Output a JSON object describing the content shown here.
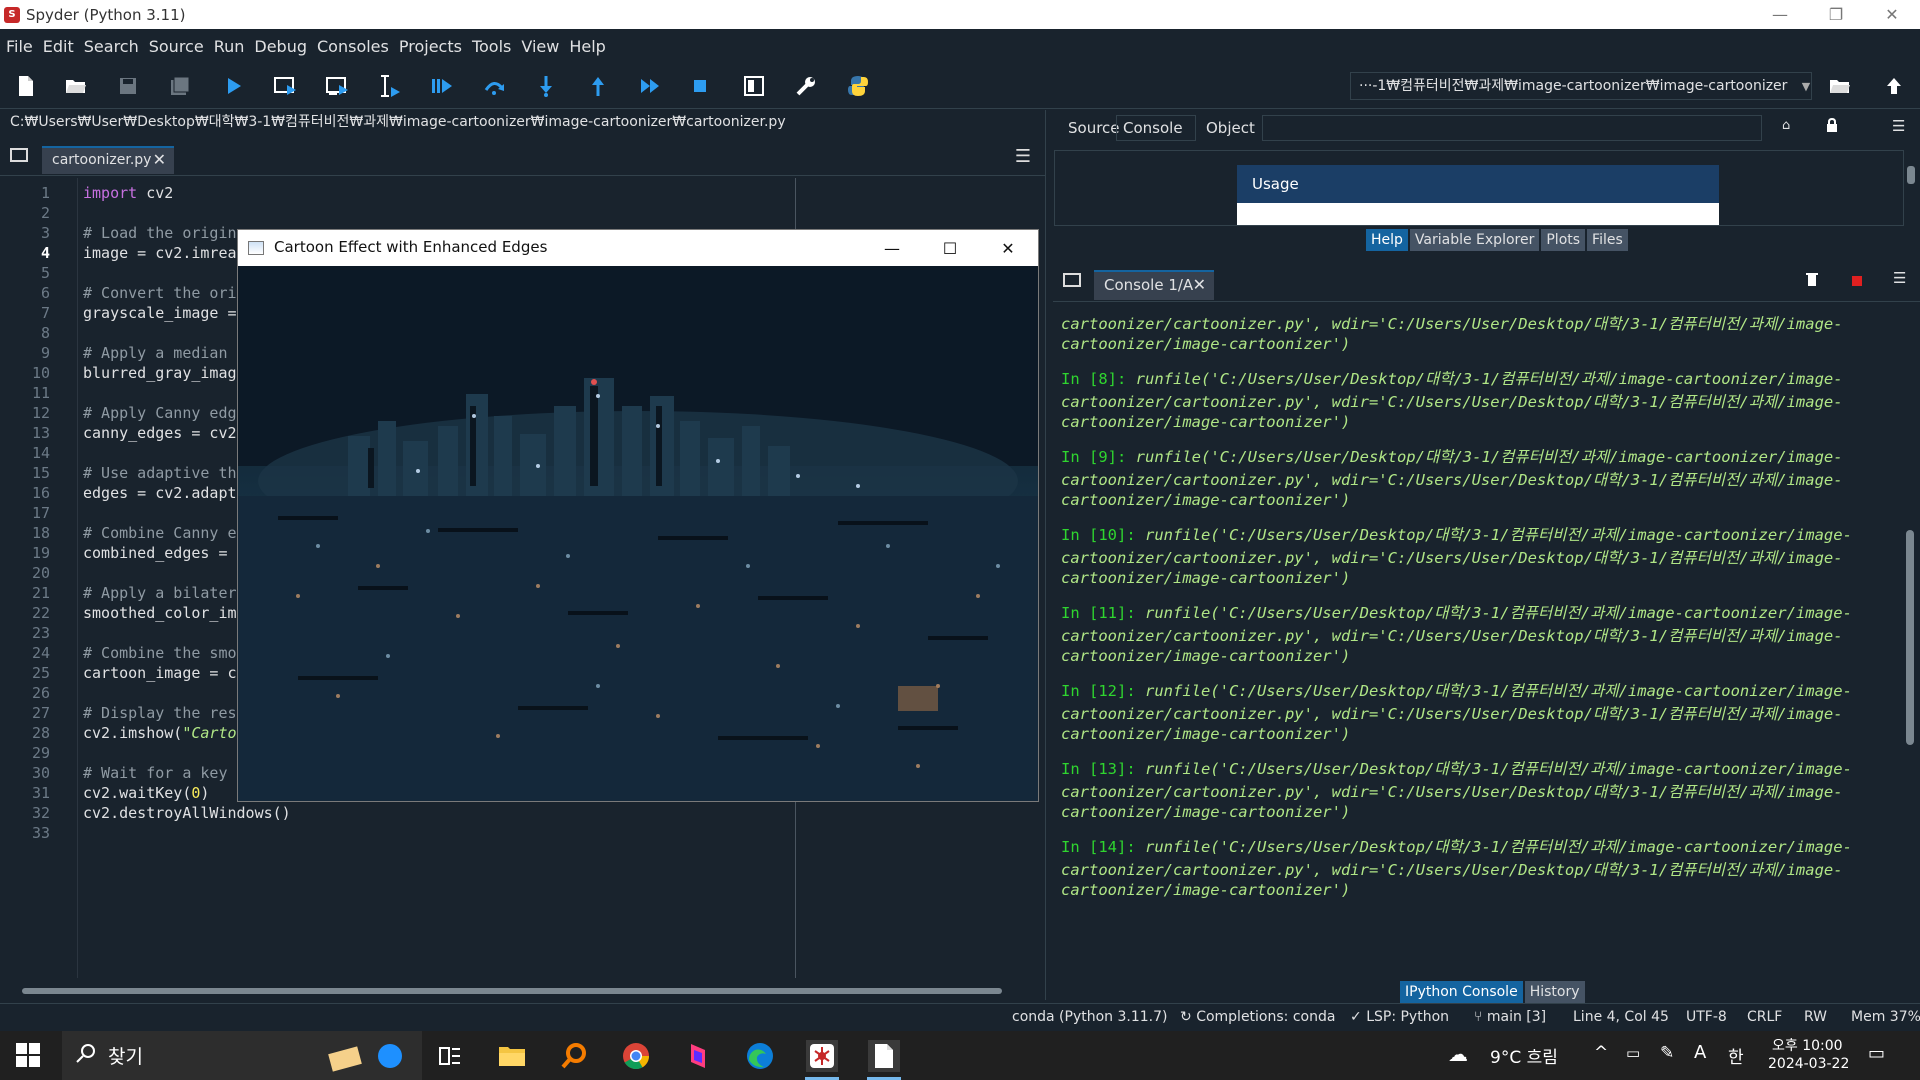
{
  "window": {
    "title": "Spyder (Python 3.11)",
    "minimize": "—",
    "restore": "❐",
    "close": "✕"
  },
  "menu": [
    "File",
    "Edit",
    "Search",
    "Source",
    "Run",
    "Debug",
    "Consoles",
    "Projects",
    "Tools",
    "View",
    "Help"
  ],
  "toolbar": {
    "working_dir": "···-1₩컴퓨터비전₩과제₩image-cartoonizer₩image-cartoonizer",
    "icons": [
      "new-file-icon",
      "open-file-icon",
      "save-icon",
      "save-all-icon",
      "run-icon",
      "run-cell-icon",
      "run-cell-advance-icon",
      "run-selection-icon",
      "debug-icon",
      "step-icon",
      "step-into-icon",
      "step-return-icon",
      "continue-icon",
      "stop-icon",
      "maximize-pane-icon",
      "preferences-icon",
      "python-path-icon"
    ]
  },
  "editor": {
    "file_path": "C:₩Users₩User₩Desktop₩대학₩3-1₩컴퓨터비전₩과제₩image-cartoonizer₩image-cartoonizer₩cartoonizer.py",
    "tab_label": "cartoonizer.py",
    "tab_close": "✕",
    "active_line": 4,
    "line_numbers": [
      "1",
      "2",
      "3",
      "4",
      "5",
      "6",
      "7",
      "8",
      "9",
      "10",
      "11",
      "12",
      "13",
      "14",
      "15",
      "16",
      "17",
      "18",
      "19",
      "20",
      "21",
      "22",
      "23",
      "24",
      "25",
      "26",
      "27",
      "28",
      "29",
      "30",
      "31",
      "32",
      "33"
    ]
  },
  "cv_window": {
    "title": "Cartoon Effect with Enhanced Edges",
    "minimize": "—",
    "maximize": "☐",
    "close": "✕"
  },
  "help_pane": {
    "source_label": "Source",
    "source_value": "Console",
    "object_label": "Object",
    "usage_title": "Usage",
    "tabs": [
      "Help",
      "Variable Explorer",
      "Plots",
      "Files"
    ]
  },
  "console": {
    "tab_label": "Console 1/A",
    "tab_close": "✕",
    "lines": [
      {
        "prompt": "",
        "text": "cartoonizer/cartoonizer.py', wdir='C:/Users/User/Desktop/대학/3-1/컴퓨터비전/과제/image-"
      },
      {
        "prompt": "",
        "text": "cartoonizer/image-cartoonizer')"
      },
      {
        "prompt": "In [8]:",
        "text": " runfile('C:/Users/User/Desktop/대학/3-1/컴퓨터비전/과제/image-cartoonizer/image-"
      },
      {
        "prompt": "",
        "text": "cartoonizer/cartoonizer.py', wdir='C:/Users/User/Desktop/대학/3-1/컴퓨터비전/과제/image-"
      },
      {
        "prompt": "",
        "text": "cartoonizer/image-cartoonizer')"
      },
      {
        "prompt": "In [9]:",
        "text": " runfile('C:/Users/User/Desktop/대학/3-1/컴퓨터비전/과제/image-cartoonizer/image-"
      },
      {
        "prompt": "",
        "text": "cartoonizer/cartoonizer.py', wdir='C:/Users/User/Desktop/대학/3-1/컴퓨터비전/과제/image-"
      },
      {
        "prompt": "",
        "text": "cartoonizer/image-cartoonizer')"
      },
      {
        "prompt": "In [10]:",
        "text": " runfile('C:/Users/User/Desktop/대학/3-1/컴퓨터비전/과제/image-cartoonizer/image-"
      },
      {
        "prompt": "",
        "text": "cartoonizer/cartoonizer.py', wdir='C:/Users/User/Desktop/대학/3-1/컴퓨터비전/과제/image-"
      },
      {
        "prompt": "",
        "text": "cartoonizer/image-cartoonizer')"
      },
      {
        "prompt": "In [11]:",
        "text": " runfile('C:/Users/User/Desktop/대학/3-1/컴퓨터비전/과제/image-cartoonizer/image-"
      },
      {
        "prompt": "",
        "text": "cartoonizer/cartoonizer.py', wdir='C:/Users/User/Desktop/대학/3-1/컴퓨터비전/과제/image-"
      },
      {
        "prompt": "",
        "text": "cartoonizer/image-cartoonizer')"
      },
      {
        "prompt": "In [12]:",
        "text": " runfile('C:/Users/User/Desktop/대학/3-1/컴퓨터비전/과제/image-cartoonizer/image-"
      },
      {
        "prompt": "",
        "text": "cartoonizer/cartoonizer.py', wdir='C:/Users/User/Desktop/대학/3-1/컴퓨터비전/과제/image-"
      },
      {
        "prompt": "",
        "text": "cartoonizer/image-cartoonizer')"
      },
      {
        "prompt": "In [13]:",
        "text": " runfile('C:/Users/User/Desktop/대학/3-1/컴퓨터비전/과제/image-cartoonizer/image-"
      },
      {
        "prompt": "",
        "text": "cartoonizer/cartoonizer.py', wdir='C:/Users/User/Desktop/대학/3-1/컴퓨터비전/과제/image-"
      },
      {
        "prompt": "",
        "text": "cartoonizer/image-cartoonizer')"
      },
      {
        "prompt": "In [14]:",
        "text": " runfile('C:/Users/User/Desktop/대학/3-1/컴퓨터비전/과제/image-cartoonizer/image-"
      },
      {
        "prompt": "",
        "text": "cartoonizer/cartoonizer.py', wdir='C:/Users/User/Desktop/대학/3-1/컴퓨터비전/과제/image-"
      },
      {
        "prompt": "",
        "text": "cartoonizer/image-cartoonizer')"
      }
    ],
    "bottom_tabs": [
      "IPython Console",
      "History"
    ]
  },
  "status": {
    "env": "conda (Python 3.11.7)",
    "completions": "Completions: conda",
    "lsp": "LSP: Python",
    "git": "main [3]",
    "position": "Line 4, Col 45",
    "encoding": "UTF-8",
    "eol": "CRLF",
    "permissions": "RW",
    "memory": "Mem 37%"
  },
  "taskbar": {
    "search_label": "찾기",
    "weather": "9°C 흐림",
    "ime_mode": "A",
    "ime_lang": "한",
    "time": "오후 10:00",
    "date": "2024-03-22",
    "icons": [
      "start-icon",
      "search-icon",
      "task-view-icon",
      "file-explorer-icon",
      "search-app-icon",
      "chrome-icon",
      "app-icon",
      "edge-icon",
      "spyder-icon",
      "notepad-icon"
    ]
  },
  "colors": {
    "background": "#19232d",
    "accent": "#1464a0",
    "prompt": "#2fd52f",
    "string": "#b0e686",
    "keyword": "#c670e0"
  }
}
